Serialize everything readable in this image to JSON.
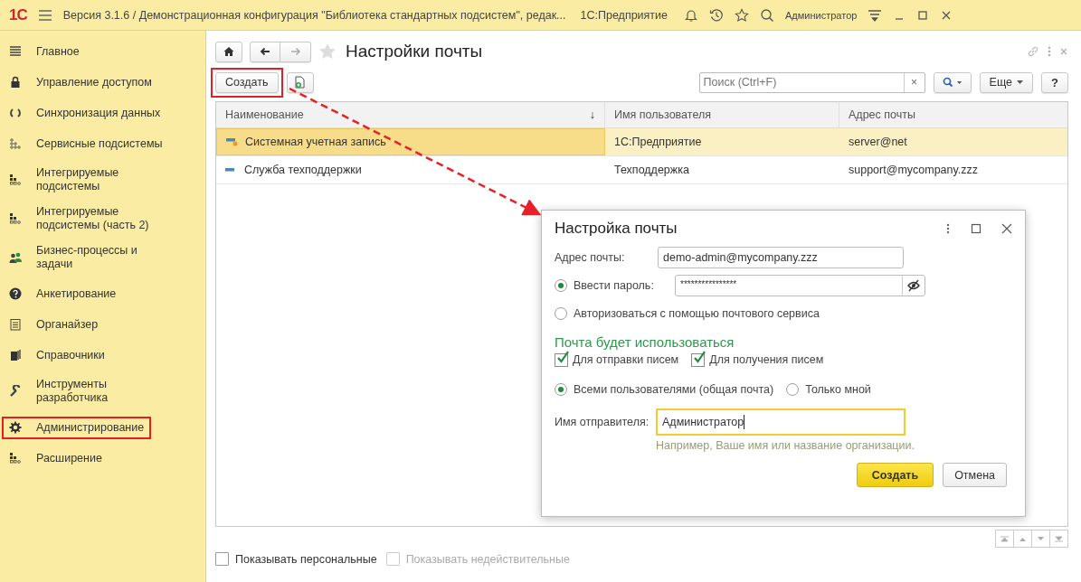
{
  "window": {
    "logo": "1С",
    "title": "Версия 3.1.6 / Демонстрационная конфигурация \"Библиотека стандартных подсистем\", редак...",
    "app": "1С:Предприятие",
    "user": "Администратор"
  },
  "sidebar": {
    "items": [
      {
        "label": "Главное",
        "marked": false
      },
      {
        "label": "Управление доступом",
        "marked": false
      },
      {
        "label": "Синхронизация данных",
        "marked": false
      },
      {
        "label": "Сервисные подсистемы",
        "marked": false
      },
      {
        "label": "Интегрируемые подсистемы",
        "marked": false
      },
      {
        "label": "Интегрируемые подсистемы (часть 2)",
        "marked": false
      },
      {
        "label": "Бизнес-процессы и задачи",
        "marked": false
      },
      {
        "label": "Анкетирование",
        "marked": false
      },
      {
        "label": "Органайзер",
        "marked": false
      },
      {
        "label": "Справочники",
        "marked": false
      },
      {
        "label": "Инструменты разработчика",
        "marked": false
      },
      {
        "label": "Администрирование",
        "marked": true
      },
      {
        "label": "Расширение",
        "marked": false
      }
    ]
  },
  "form": {
    "title": "Настройки почты",
    "create_button": {
      "label": "Создать",
      "marked": true
    },
    "search": {
      "placeholder": "Поиск (Ctrl+F)"
    },
    "clear": "×",
    "more": "Еще",
    "help": "?",
    "table": {
      "columns": [
        {
          "label": "Наименование",
          "sort": "↓"
        },
        {
          "label": "Имя пользователя"
        },
        {
          "label": "Адрес почты"
        }
      ],
      "rows": [
        {
          "kind": "system",
          "selected": true,
          "cells": [
            "Системная учетная запись",
            "1С:Предприятие",
            "server@net"
          ]
        },
        {
          "kind": "plain",
          "selected": false,
          "cells": [
            "Служба техподдержки",
            "Техподдержка",
            "support@mycompany.zzz"
          ]
        }
      ]
    },
    "options": [
      {
        "label": "Показывать персональные",
        "checked": false,
        "disabled": false
      },
      {
        "label": "Показывать недействительные",
        "checked": false,
        "disabled": true
      }
    ]
  },
  "dialog": {
    "title": "Настройка почты",
    "address_label": "Адрес почты:",
    "address": "demo-admin@mycompany.zzz",
    "auth": [
      {
        "label": "Ввести пароль:",
        "selected": true
      },
      {
        "label": "Авторизоваться с помощью почтового сервиса",
        "selected": false
      }
    ],
    "password": "****************",
    "usage_heading": "Почта будет использоваться",
    "usage": [
      {
        "label": "Для отправки писем",
        "checked": true
      },
      {
        "label": "Для получения писем",
        "checked": true
      }
    ],
    "audience": [
      {
        "label": "Всеми пользователями (общая почта)",
        "selected": true
      },
      {
        "label": "Только мной",
        "selected": false
      }
    ],
    "sender_label": "Имя отправителя:",
    "sender": "Администратор",
    "sender_hint": "Например, Ваше имя или название организации.",
    "buttons": [
      {
        "label": "Создать",
        "kind": "primary"
      },
      {
        "label": "Отмена",
        "kind": "secondary"
      }
    ]
  }
}
